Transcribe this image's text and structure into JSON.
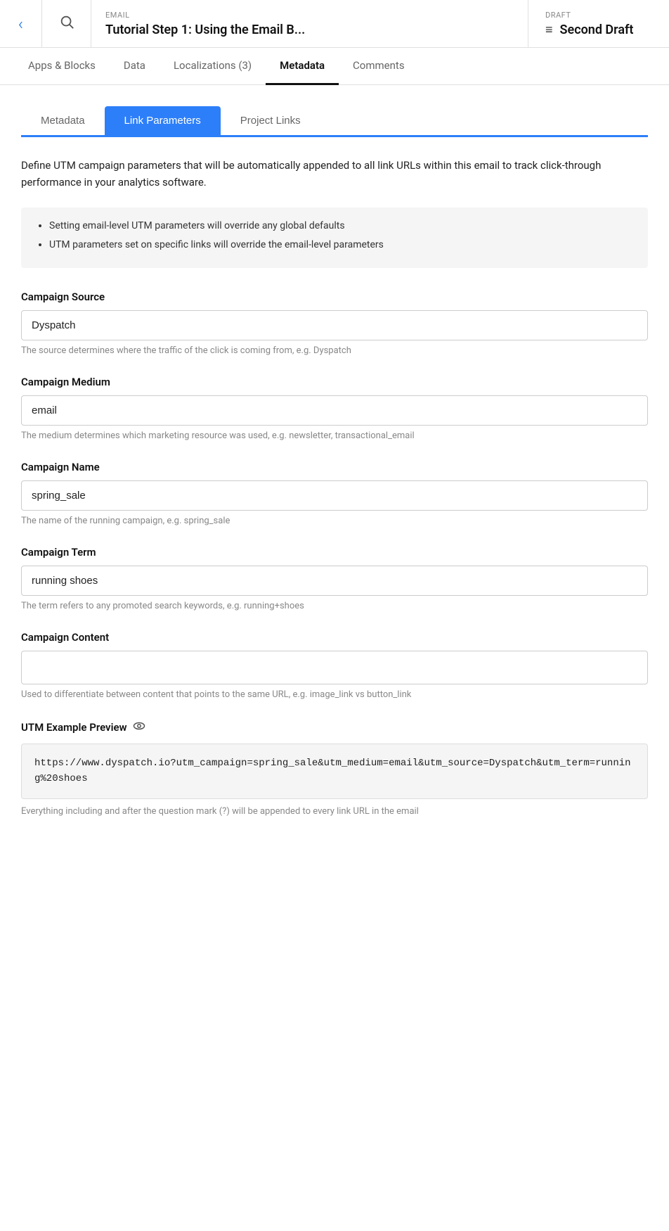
{
  "header": {
    "email_label": "EMAIL",
    "email_title": "Tutorial Step 1: Using the Email B...",
    "draft_label": "DRAFT",
    "draft_title": "Second Draft",
    "back_icon": "‹",
    "search_icon": "🔍",
    "hamburger_icon": "≡"
  },
  "nav": {
    "tabs": [
      {
        "id": "apps-blocks",
        "label": "Apps & Blocks"
      },
      {
        "id": "data",
        "label": "Data"
      },
      {
        "id": "localizations",
        "label": "Localizations (3)"
      },
      {
        "id": "metadata",
        "label": "Metadata",
        "active": true
      },
      {
        "id": "comments",
        "label": "Comments"
      }
    ]
  },
  "sub_tabs": [
    {
      "id": "metadata",
      "label": "Metadata"
    },
    {
      "id": "link-parameters",
      "label": "Link Parameters",
      "active": true
    },
    {
      "id": "project-links",
      "label": "Project Links"
    }
  ],
  "description": "Define UTM campaign parameters that will be automatically appended to all link URLs within this email to track click-through performance in your analytics software.",
  "info_bullets": [
    "Setting email-level UTM parameters will override any global defaults",
    "UTM parameters set on specific links will override the email-level parameters"
  ],
  "fields": {
    "campaign_source": {
      "label": "Campaign Source",
      "value": "Dyspatch",
      "hint": "The source determines where the traffic of the click is coming from, e.g. Dyspatch"
    },
    "campaign_medium": {
      "label": "Campaign Medium",
      "value": "email",
      "hint": "The medium determines which marketing resource was used, e.g. newsletter, transactional_email"
    },
    "campaign_name": {
      "label": "Campaign Name",
      "value": "spring_sale",
      "hint": "The name of the running campaign, e.g. spring_sale"
    },
    "campaign_term": {
      "label": "Campaign Term",
      "value": "running shoes",
      "hint": "The term refers to any promoted search keywords, e.g. running+shoes"
    },
    "campaign_content": {
      "label": "Campaign Content",
      "value": "",
      "hint": "Used to differentiate between content that points to the same URL, e.g. image_link vs button_link"
    }
  },
  "utm_preview": {
    "label": "UTM Example Preview",
    "url": "https://www.dyspatch.io?utm_campaign=spring_sale&utm_medium=email&utm_source=Dyspatch&utm_term=running%20shoes",
    "hint": "Everything including and after the question mark (?) will be appended to every link URL in the email"
  }
}
